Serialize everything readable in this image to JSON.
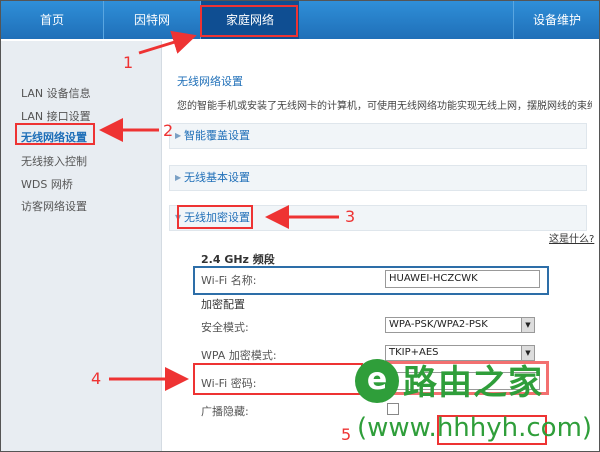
{
  "topnav": {
    "tabs": [
      {
        "label": "首页"
      },
      {
        "label": "因特网"
      },
      {
        "label": "家庭网络"
      },
      {
        "label": "设备维护"
      }
    ]
  },
  "sidebar": {
    "items": [
      {
        "label": "LAN 设备信息"
      },
      {
        "label": "LAN 接口设置"
      },
      {
        "label": "无线网络设置"
      },
      {
        "label": "无线接入控制"
      },
      {
        "label": "WDS 网桥"
      },
      {
        "label": "访客网络设置"
      }
    ]
  },
  "main": {
    "title": "无线网络设置",
    "description": "您的智能手机或安装了无线网卡的计算机，可使用无线网络功能实现无线上网，摆脱网线的束缚。",
    "sections": {
      "coverage": "智能覆盖设置",
      "basic": "无线基本设置",
      "encryption": "无线加密设置"
    },
    "help_link": "这是什么?",
    "band_heading": "2.4 GHz 频段",
    "wifi_name_label": "Wi-Fi 名称:",
    "wifi_name_value": "HUAWEI-HCZCWK",
    "encryption_heading": "加密配置",
    "security_mode_label": "安全模式:",
    "security_mode_value": "WPA-PSK/WPA2-PSK",
    "wpa_mode_label": "WPA 加密模式:",
    "wpa_mode_value": "TKIP+AES",
    "wifi_password_label": "Wi-Fi 密码:",
    "broadcast_hide_label": "广播隐藏:"
  },
  "annotations": [
    "1",
    "2",
    "3",
    "4",
    "5"
  ],
  "watermark": {
    "logo_glyph": "e",
    "text": "路由之家",
    "url": "(www.hhhyh.com)"
  }
}
